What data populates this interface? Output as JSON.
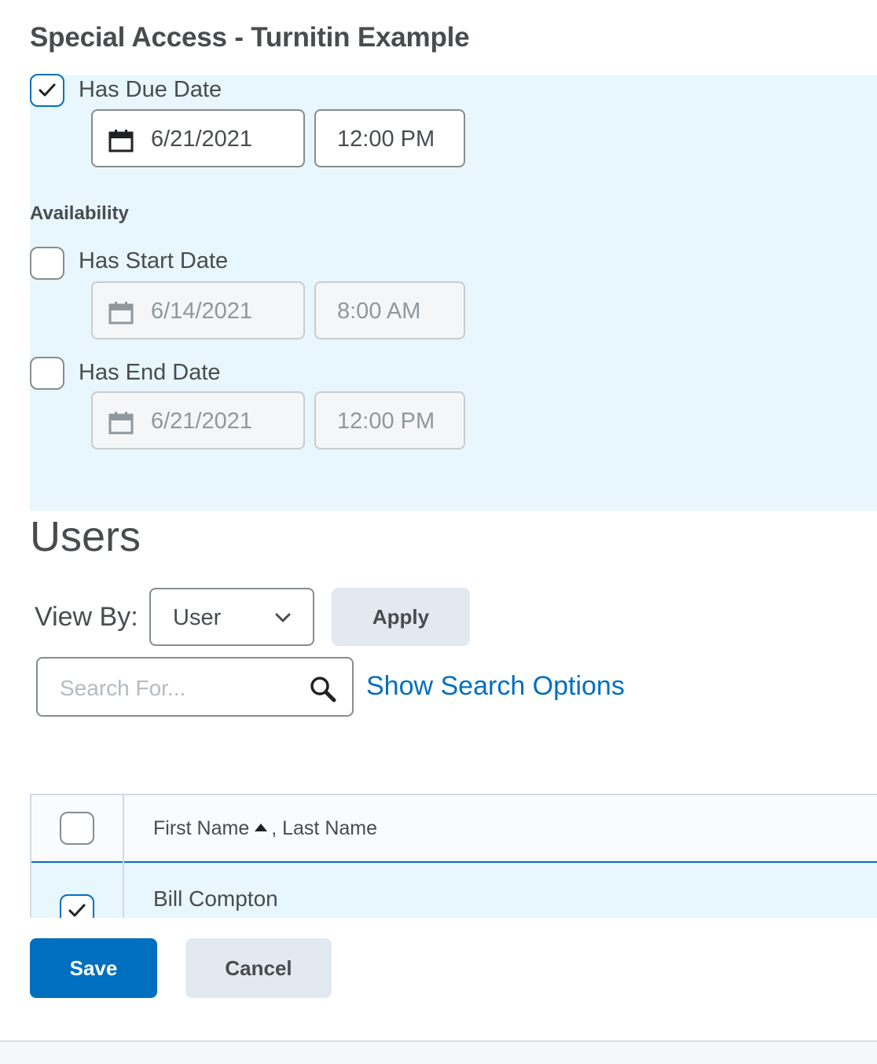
{
  "page": {
    "title": "Special Access - Turnitin Example"
  },
  "due_date": {
    "label": "Has Due Date",
    "checked": true,
    "date": "6/21/2021",
    "time": "12:00 PM"
  },
  "availability": {
    "label": "Availability",
    "start": {
      "label": "Has Start Date",
      "checked": false,
      "date": "6/14/2021",
      "time": "8:00 AM"
    },
    "end": {
      "label": "Has End Date",
      "checked": false,
      "date": "6/21/2021",
      "time": "12:00 PM"
    }
  },
  "users": {
    "heading": "Users",
    "view_by_label": "View By:",
    "view_by_value": "User",
    "apply_label": "Apply",
    "search_placeholder": "Search For...",
    "show_search_options": "Show Search Options",
    "table": {
      "header_first": "First Name",
      "header_last": ", Last Name",
      "rows": [
        {
          "name": "Bill Compton",
          "checked": true
        }
      ]
    }
  },
  "actions": {
    "save_label": "Save",
    "cancel_label": "Cancel"
  },
  "colors": {
    "accent": "#006fbf",
    "panel_bg": "#e8f6fd",
    "secondary_button": "#e3e9f1"
  },
  "icons": {
    "calendar": "calendar-icon",
    "search": "search-icon",
    "chevron": "chevron-down-icon",
    "check": "checkmark-icon",
    "sort": "sort-ascending-icon"
  }
}
